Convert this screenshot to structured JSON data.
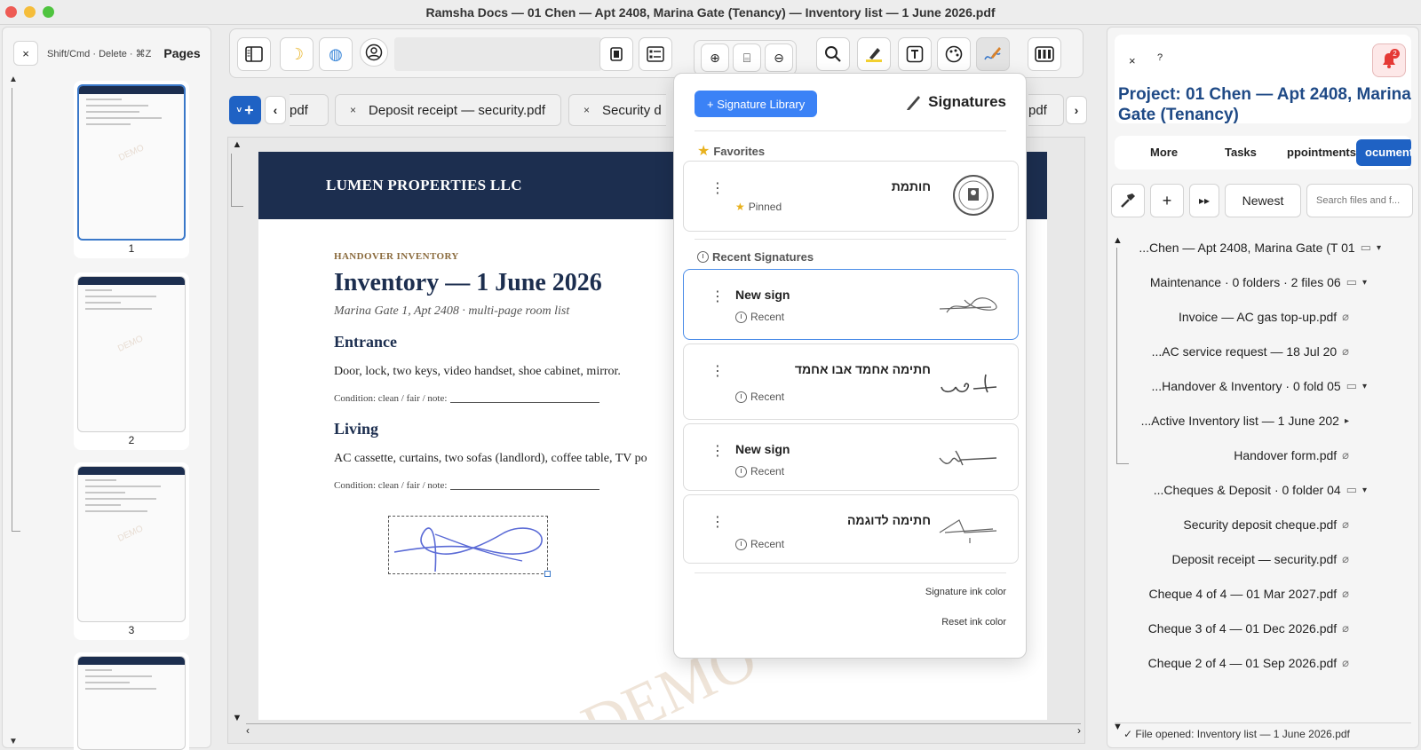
{
  "window": {
    "title": "Ramsha Docs — 01 Chen — Apt 2408, Marina Gate (Tenancy) — Inventory list — 1 June 2026.pdf"
  },
  "pages_panel": {
    "close_label": "×",
    "hint": "Shift/Cmd · Delete · ⌘Z",
    "label": "Pages",
    "thumbnails": [
      {
        "num": "1",
        "watermark": "DEMO"
      },
      {
        "num": "2",
        "watermark": "DEMO"
      },
      {
        "num": "3",
        "watermark": "DEMO"
      }
    ]
  },
  "toolbar": {
    "search_placeholder": ""
  },
  "tabs": {
    "plus": "+",
    "prev": "‹",
    "next": "›",
    "items": [
      {
        "label": "pdf",
        "close": ""
      },
      {
        "label": "Deposit receipt — security.pdf",
        "close": "×"
      },
      {
        "label": "Security d",
        "close": "×"
      },
      {
        "label": "pdf",
        "close": ""
      }
    ]
  },
  "document": {
    "company": "LUMEN PROPERTIES LLC",
    "kicker": "HANDOVER INVENTORY",
    "title": "Inventory — 1 June 2026",
    "subtitle": "Marina Gate 1, Apt 2408 · multi-page room list",
    "sections": [
      {
        "heading": "Entrance",
        "body": "Door, lock, two keys, video handset, shoe cabinet, mirror.",
        "condition": "Condition: clean / fair / note:"
      },
      {
        "heading": "Living",
        "body": "AC cassette, curtains, two sofas (landlord), coffee table, TV po",
        "condition": "Condition: clean / fair / note:"
      }
    ],
    "watermark": "DEMO"
  },
  "signatures": {
    "library_button": "+ Signature Library",
    "title": "Signatures",
    "favorites_label": "Favorites",
    "recent_label": "Recent Signatures",
    "favorites": [
      {
        "name": "חותמת",
        "status": "Pinned"
      }
    ],
    "recent": [
      {
        "name": "New sign",
        "status": "Recent"
      },
      {
        "name": "חתימה אחמד אבו אחמד",
        "status": "Recent"
      },
      {
        "name": "New sign",
        "status": "Recent"
      },
      {
        "name": "חתימה לדוגמה",
        "status": "Recent"
      }
    ],
    "ink_color_label": "Signature ink color",
    "reset_ink_label": "Reset ink color",
    "ink_color": "#5b6bd6"
  },
  "right_panel": {
    "close": "×",
    "help": "?",
    "notification_count": "2",
    "project_title": "Project: 01 Chen — Apt 2408, Marina Gate (Tenancy)",
    "tabs": [
      "More",
      "Tasks",
      "ppointments",
      "ocuments ·"
    ],
    "sort_label": "Newest",
    "search_placeholder": "Search files and f...",
    "tree": [
      {
        "label": "...Chen — Apt 2408, Marina Gate (T 01",
        "icon": "folder",
        "caret": "▾"
      },
      {
        "label": "Maintenance  ·  0 folders · 2 files 06",
        "icon": "folder",
        "caret": "▾"
      },
      {
        "label": "Invoice — AC gas top-up.pdf",
        "icon": "clip",
        "caret": ""
      },
      {
        "label": "...AC service request — 18 Jul 20",
        "icon": "clip",
        "caret": ""
      },
      {
        "label": "...Handover & Inventory  ·  0 fold 05",
        "icon": "folder",
        "caret": "▾"
      },
      {
        "label": "...Active Inventory list — 1 June 202",
        "icon": "",
        "caret": "▸"
      },
      {
        "label": "Handover form.pdf",
        "icon": "clip",
        "caret": ""
      },
      {
        "label": "...Cheques & Deposit  ·  0 folder 04",
        "icon": "folder",
        "caret": "▾"
      },
      {
        "label": "Security deposit cheque.pdf",
        "icon": "clip",
        "caret": ""
      },
      {
        "label": "Deposit receipt — security.pdf",
        "icon": "clip",
        "caret": ""
      },
      {
        "label": "Cheque 4 of 4 — 01 Mar 2027.pdf",
        "icon": "clip",
        "caret": ""
      },
      {
        "label": "Cheque 3 of 4 — 01 Dec 2026.pdf",
        "icon": "clip",
        "caret": ""
      },
      {
        "label": "Cheque 2 of 4 — 01 Sep 2026.pdf",
        "icon": "clip",
        "caret": ""
      }
    ],
    "status": "✓ File opened: Inventory list — 1 June 2026.pdf"
  }
}
